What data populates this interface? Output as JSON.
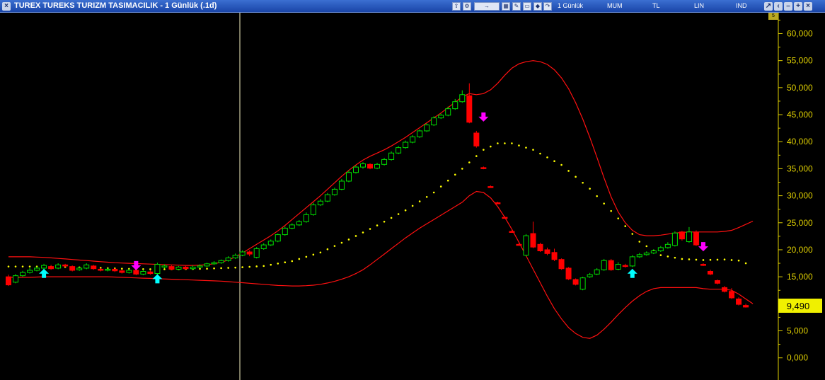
{
  "window": {
    "title": "TUREX TUREKS TURIZM TASIMACILIK - 1 Günlük (.1d)",
    "period": "1 Günlük",
    "chart_style": "MUM",
    "currency": "TL",
    "scale": "LIN",
    "indicator": "IND",
    "toolbar_badge": "5"
  },
  "icons": [
    "export-icon",
    "settings-icon",
    "forward-icon",
    "table-icon",
    "pencil-icon",
    "window-icon",
    "diamond-icon",
    "arrow-curve-icon"
  ],
  "colors": {
    "background": "#000000",
    "up_candle": "#00e000",
    "down_candle": "#ff0000",
    "bollinger": "#ff1010",
    "sar": "#ffff00",
    "price_axis": "#e0d000",
    "buy_arrow": "#00ffff",
    "sell_arrow": "#ff00ff",
    "last_price_bg": "#f0f000"
  },
  "chart_data": {
    "type": "candlestick",
    "ylim": [
      -2000,
      63000
    ],
    "y_ticks": [
      "60,000",
      "55,000",
      "50,000",
      "45,000",
      "40,000",
      "35,000",
      "30,000",
      "25,000",
      "20,000",
      "15,000",
      "10,000",
      "5,000",
      "0,000"
    ],
    "last_price": "9,490",
    "candles": [
      [
        15000,
        13500,
        15400,
        13300
      ],
      [
        14000,
        15200,
        15500,
        13800
      ],
      [
        15200,
        15800,
        16100,
        15000
      ],
      [
        15800,
        16200,
        16600,
        15600
      ],
      [
        16200,
        16600,
        16900,
        16000
      ],
      [
        16600,
        17100,
        17400,
        16400
      ],
      [
        16900,
        16500,
        17200,
        16300
      ],
      [
        16600,
        17200,
        17500,
        16400
      ],
      [
        17200,
        17000,
        17400,
        16700
      ],
      [
        16900,
        16200,
        17100,
        16000
      ],
      [
        16300,
        16600,
        16900,
        16100
      ],
      [
        16600,
        17200,
        17500,
        16400
      ],
      [
        17000,
        16500,
        17200,
        16300
      ],
      [
        16400,
        16200,
        16600,
        16000
      ],
      [
        16200,
        16400,
        16700,
        16000
      ],
      [
        16400,
        16100,
        16600,
        15900
      ],
      [
        16100,
        15800,
        16300,
        15600
      ],
      [
        15800,
        16200,
        16500,
        15600
      ],
      [
        16200,
        15500,
        16400,
        15300
      ],
      [
        15500,
        16000,
        16300,
        15300
      ],
      [
        15900,
        15600,
        16200,
        15400
      ],
      [
        15600,
        17300,
        17600,
        15400
      ],
      [
        16800,
        17000,
        17300,
        16600
      ],
      [
        16900,
        16400,
        17100,
        16200
      ],
      [
        16400,
        16800,
        17000,
        16200
      ],
      [
        16800,
        16500,
        17000,
        16300
      ],
      [
        16500,
        16800,
        17100,
        16300
      ],
      [
        16800,
        17000,
        17300,
        16600
      ],
      [
        17000,
        17400,
        17600,
        16800
      ],
      [
        17400,
        17600,
        17900,
        17200
      ],
      [
        17600,
        18000,
        18200,
        17400
      ],
      [
        18000,
        18500,
        18800,
        17800
      ],
      [
        18500,
        19000,
        19300,
        18300
      ],
      [
        19000,
        19600,
        19900,
        18800
      ],
      [
        19600,
        19200,
        19900,
        18800
      ],
      [
        18600,
        20200,
        20500,
        18400
      ],
      [
        20200,
        20900,
        21200,
        20000
      ],
      [
        20900,
        21600,
        21900,
        20700
      ],
      [
        21600,
        22800,
        23000,
        21400
      ],
      [
        22800,
        24000,
        24300,
        22600
      ],
      [
        24000,
        24600,
        24900,
        23800
      ],
      [
        24600,
        25200,
        25500,
        24400
      ],
      [
        25200,
        26500,
        26900,
        25000
      ],
      [
        26500,
        28300,
        28700,
        26300
      ],
      [
        28300,
        29000,
        29400,
        28100
      ],
      [
        29000,
        30200,
        30500,
        28800
      ],
      [
        30200,
        31200,
        31500,
        30000
      ],
      [
        31200,
        32700,
        33100,
        31000
      ],
      [
        32700,
        34300,
        34700,
        32500
      ],
      [
        34300,
        35300,
        35600,
        34100
      ],
      [
        35300,
        35900,
        36200,
        35000
      ],
      [
        35800,
        35100,
        36000,
        34900
      ],
      [
        35100,
        35800,
        36100,
        34900
      ],
      [
        35800,
        36700,
        37000,
        35600
      ],
      [
        36700,
        37900,
        38200,
        36500
      ],
      [
        37900,
        38900,
        39200,
        37700
      ],
      [
        38900,
        39900,
        40200,
        38700
      ],
      [
        39900,
        40900,
        41200,
        39700
      ],
      [
        40900,
        42000,
        42300,
        40700
      ],
      [
        42000,
        43100,
        43400,
        41800
      ],
      [
        43100,
        44400,
        44700,
        42900
      ],
      [
        44400,
        44900,
        45200,
        44200
      ],
      [
        44900,
        46100,
        46500,
        44700
      ],
      [
        46100,
        47400,
        47900,
        45900
      ],
      [
        47400,
        48700,
        49500,
        47200
      ],
      [
        48500,
        43600,
        50800,
        43400
      ],
      [
        41600,
        39200,
        42000,
        38900
      ],
      [
        35200,
        35100,
        35400,
        34900
      ],
      [
        31700,
        31600,
        31900,
        31500
      ],
      [
        28700,
        28600,
        28900,
        28500
      ],
      [
        26000,
        25900,
        26200,
        25800
      ],
      [
        23400,
        23300,
        23600,
        23200
      ],
      [
        21000,
        20900,
        21200,
        20800
      ],
      [
        19000,
        22600,
        22900,
        18800
      ],
      [
        23000,
        20500,
        25200,
        20300
      ],
      [
        21000,
        19800,
        21300,
        19600
      ],
      [
        20000,
        19300,
        20400,
        19000
      ],
      [
        19500,
        18200,
        20200,
        17900
      ],
      [
        18200,
        16500,
        18400,
        16300
      ],
      [
        16600,
        14600,
        16800,
        14400
      ],
      [
        14500,
        13600,
        14700,
        13400
      ],
      [
        12700,
        14800,
        15000,
        12500
      ],
      [
        15000,
        15400,
        15700,
        14800
      ],
      [
        15500,
        16300,
        16600,
        15300
      ],
      [
        16300,
        18000,
        18300,
        16100
      ],
      [
        18000,
        16300,
        18300,
        16100
      ],
      [
        16400,
        17300,
        17700,
        16200
      ],
      [
        17100,
        16900,
        17400,
        16700
      ],
      [
        17000,
        18700,
        19000,
        16800
      ],
      [
        18700,
        19100,
        19400,
        18500
      ],
      [
        19100,
        19400,
        19700,
        18900
      ],
      [
        19400,
        19800,
        20100,
        19200
      ],
      [
        19800,
        20400,
        20700,
        19600
      ],
      [
        20400,
        21000,
        21400,
        20200
      ],
      [
        20800,
        23100,
        23400,
        20600
      ],
      [
        23300,
        22000,
        23500,
        21700
      ],
      [
        21500,
        23300,
        24200,
        21300
      ],
      [
        23200,
        20900,
        23600,
        20700
      ],
      [
        17300,
        17200,
        17500,
        17000
      ],
      [
        16000,
        15500,
        16300,
        15300
      ],
      [
        14300,
        13800,
        14500,
        13600
      ],
      [
        13000,
        12300,
        13300,
        12100
      ],
      [
        12300,
        11100,
        12900,
        10900
      ],
      [
        10900,
        9900,
        11200,
        9700
      ],
      [
        9700,
        9400,
        10000,
        9300
      ]
    ],
    "upper_band": [
      18700,
      18700,
      18700,
      18700,
      18650,
      18600,
      18500,
      18400,
      18300,
      18200,
      18100,
      18000,
      17900,
      17800,
      17700,
      17600,
      17550,
      17500,
      17450,
      17400,
      17350,
      17300,
      17250,
      17200,
      17150,
      17100,
      17100,
      17150,
      17250,
      17400,
      17700,
      18100,
      18700,
      19400,
      20200,
      21000,
      21800,
      22600,
      23500,
      24500,
      25600,
      26700,
      27800,
      28900,
      30000,
      31200,
      32400,
      33600,
      34700,
      35700,
      36600,
      37300,
      37900,
      38500,
      39200,
      40000,
      40800,
      41700,
      42600,
      43500,
      44400,
      45300,
      46300,
      47300,
      48300,
      48900,
      48700,
      48900,
      49600,
      50800,
      52300,
      53600,
      54400,
      54800,
      55000,
      54800,
      54300,
      53300,
      51800,
      49800,
      47200,
      44200,
      40800,
      37100,
      33300,
      29800,
      27000,
      25000,
      23600,
      22800,
      22600,
      22600,
      22700,
      22900,
      23100,
      23200,
      23300,
      23300,
      23300,
      23300,
      23300,
      23400,
      23600,
      24100,
      24700,
      25300
    ],
    "lower_band": [
      14900,
      14900,
      14900,
      14900,
      14950,
      15000,
      15000,
      15000,
      15000,
      15000,
      15000,
      15000,
      15000,
      15000,
      15000,
      14950,
      14900,
      14850,
      14800,
      14750,
      14700,
      14650,
      14600,
      14550,
      14500,
      14450,
      14400,
      14350,
      14300,
      14250,
      14200,
      14100,
      14000,
      13900,
      13800,
      13700,
      13600,
      13500,
      13400,
      13350,
      13300,
      13300,
      13350,
      13450,
      13600,
      13850,
      14150,
      14550,
      15000,
      15600,
      16300,
      17200,
      18200,
      19200,
      20200,
      21200,
      22200,
      23100,
      24000,
      24800,
      25600,
      26400,
      27200,
      28000,
      28800,
      30000,
      30800,
      30600,
      29600,
      28000,
      26000,
      23800,
      21400,
      18900,
      16400,
      13900,
      11400,
      9100,
      7200,
      5600,
      4500,
      3800,
      3600,
      4200,
      5300,
      6600,
      8000,
      9300,
      10500,
      11500,
      12300,
      12800,
      13000,
      13000,
      13000,
      13000,
      13000,
      13000,
      12800,
      12700,
      12700,
      12700,
      12500,
      11800,
      10900,
      10000
    ],
    "sar": [
      [
        0,
        16900
      ],
      [
        4,
        16900
      ],
      [
        8,
        16800
      ],
      [
        12,
        16700
      ],
      [
        16,
        16500
      ],
      [
        20,
        16400
      ],
      [
        24,
        16400
      ],
      [
        28,
        16500
      ],
      [
        32,
        16700
      ],
      [
        36,
        17000
      ],
      [
        40,
        17900
      ],
      [
        44,
        19500
      ],
      [
        48,
        21900
      ],
      [
        52,
        24500
      ],
      [
        56,
        27300
      ],
      [
        60,
        30600
      ],
      [
        64,
        35000
      ],
      [
        67,
        38500
      ],
      [
        69,
        39700
      ],
      [
        71,
        39700
      ],
      [
        74,
        38500
      ],
      [
        78,
        35700
      ],
      [
        82,
        31300
      ],
      [
        86,
        25800
      ],
      [
        89,
        21500
      ],
      [
        92,
        19000
      ],
      [
        95,
        18300
      ],
      [
        98,
        18100
      ],
      [
        101,
        18200
      ],
      [
        103,
        18000
      ],
      [
        105,
        17000
      ]
    ],
    "signals": [
      {
        "i": 5,
        "type": "buy",
        "price": 15700
      },
      {
        "i": 21,
        "type": "buy",
        "price": 14700
      },
      {
        "i": 18,
        "type": "sell",
        "price": 17000
      },
      {
        "i": 67,
        "type": "sell",
        "price": 44500
      },
      {
        "i": 88,
        "type": "buy",
        "price": 15700
      },
      {
        "i": 98,
        "type": "sell",
        "price": 20500
      }
    ]
  }
}
